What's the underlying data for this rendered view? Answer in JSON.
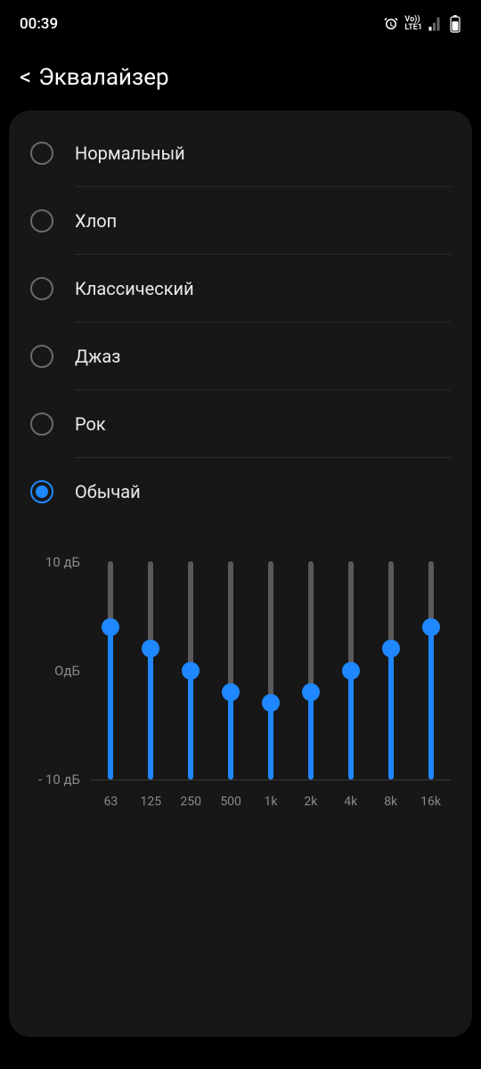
{
  "status_bar": {
    "time": "00:39",
    "volte": "Vo))",
    "lte": "LTE1"
  },
  "header": {
    "back": "<",
    "title": "Эквалайзер"
  },
  "presets": [
    {
      "label": "Нормальный",
      "selected": false
    },
    {
      "label": "Хлоп",
      "selected": false
    },
    {
      "label": "Классический",
      "selected": false
    },
    {
      "label": "Джаз",
      "selected": false
    },
    {
      "label": "Рок",
      "selected": false
    },
    {
      "label": "Обычай",
      "selected": true
    }
  ],
  "chart_data": {
    "type": "bar",
    "title": "",
    "xlabel": "",
    "ylabel": "дБ",
    "ylim": [
      -10,
      10
    ],
    "yticks": [
      {
        "value": 10,
        "label": "10 дБ"
      },
      {
        "value": 0,
        "label": "OдБ"
      },
      {
        "value": -10,
        "label": "- 10 дБ"
      }
    ],
    "categories": [
      "63",
      "125",
      "250",
      "500",
      "1k",
      "2k",
      "4k",
      "8k",
      "16k"
    ],
    "values": [
      4,
      2,
      0,
      -2,
      -3,
      -2,
      0,
      2,
      4
    ],
    "accent_color": "#1f87ff",
    "track_color": "#5a5a5a"
  }
}
